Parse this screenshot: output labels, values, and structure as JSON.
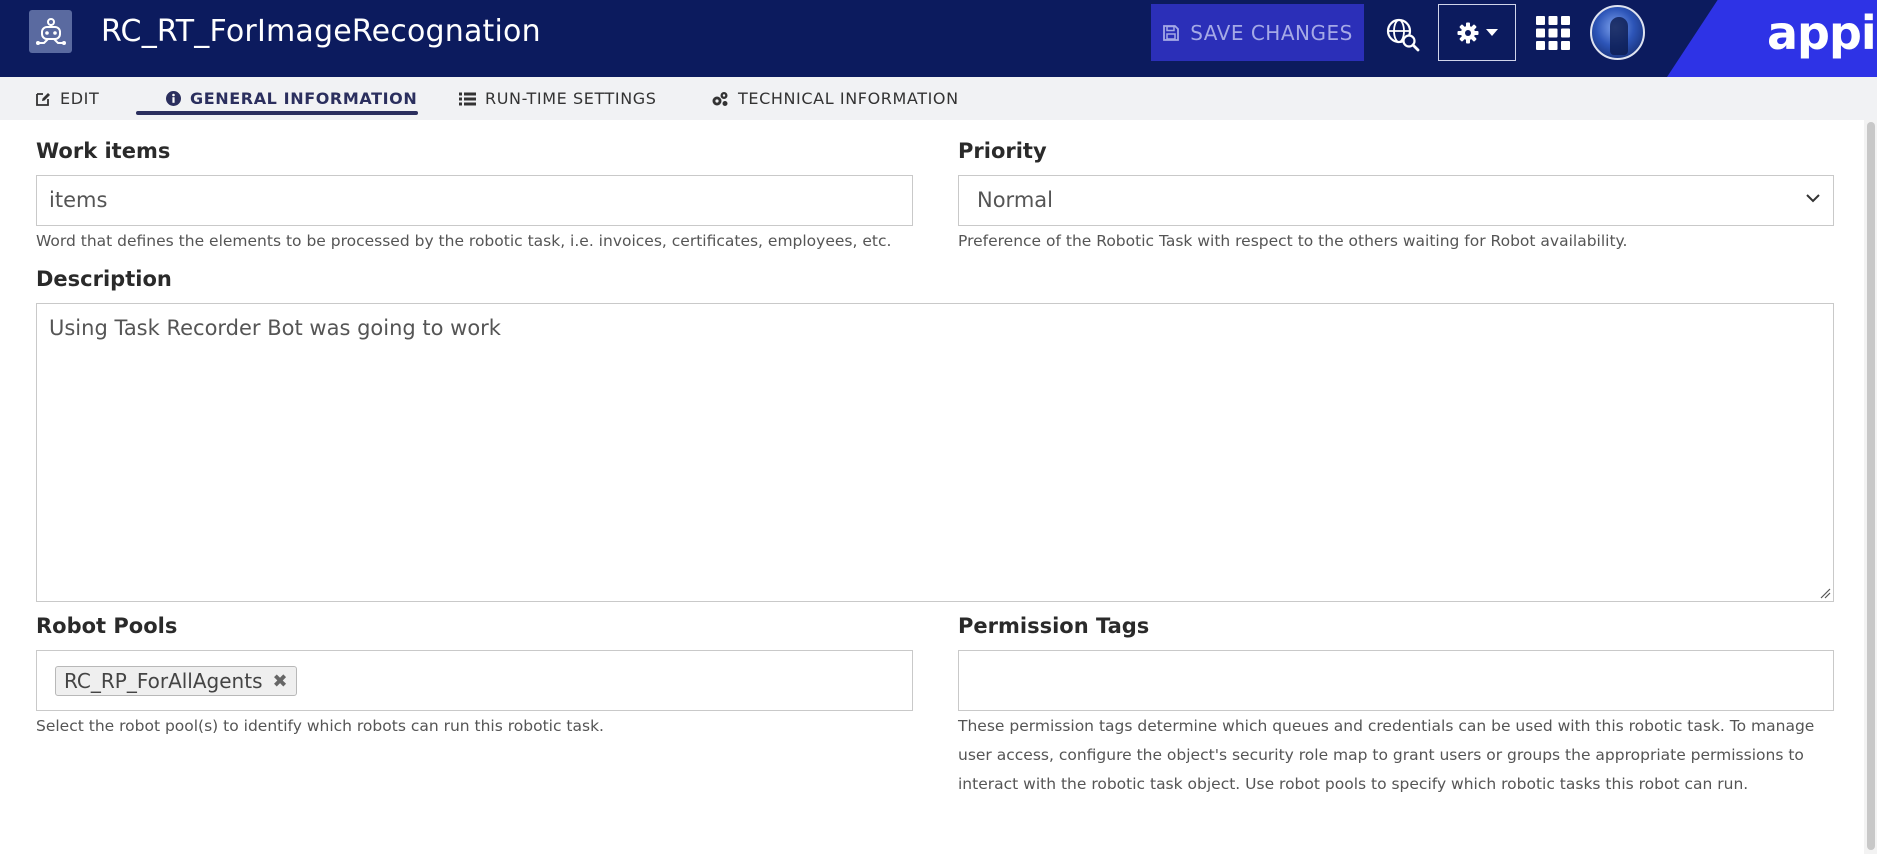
{
  "header": {
    "title": "RC_RT_ForImageRecognation",
    "save_label": "SAVE CHANGES",
    "brand": "appian",
    "icons": {
      "app": "robotic-task-icon",
      "save": "floppy-disk-icon",
      "globe": "globe-search-icon",
      "settings": "gear-icon",
      "apps": "grid-icon"
    }
  },
  "tabs": [
    {
      "label": "EDIT",
      "icon": "edit-icon"
    },
    {
      "label": "GENERAL INFORMATION",
      "icon": "info-icon",
      "active": true
    },
    {
      "label": "RUN-TIME SETTINGS",
      "icon": "list-settings-icon"
    },
    {
      "label": "TECHNICAL INFORMATION",
      "icon": "gears-icon"
    }
  ],
  "form": {
    "work_items": {
      "label": "Work items",
      "value": "items",
      "help": "Word that defines the elements to be processed by the robotic task, i.e. invoices, certificates, employees, etc."
    },
    "priority": {
      "label": "Priority",
      "value": "Normal",
      "help": "Preference of the Robotic Task with respect to the others waiting for Robot availability."
    },
    "description": {
      "label": "Description",
      "value": "Using Task Recorder  Bot was going to work"
    },
    "robot_pools": {
      "label": "Robot Pools",
      "tags": [
        "RC_RP_ForAllAgents"
      ],
      "help": "Select the robot pool(s) to identify which robots can run this robotic task."
    },
    "permission_tags": {
      "label": "Permission Tags",
      "value": "",
      "help": "These permission tags determine which queues and credentials can be used with this robotic task. To manage user access, configure the object's security role map to grant users or groups the appropriate permissions to interact with the robotic task object. Use robot pools to specify which robotic tasks this robot can run."
    }
  },
  "colors": {
    "header_bg": "#0c1b5e",
    "save_bg": "#2b2fb8",
    "brand_accent": "#2e33e6",
    "tab_active": "#2b2f5e"
  }
}
